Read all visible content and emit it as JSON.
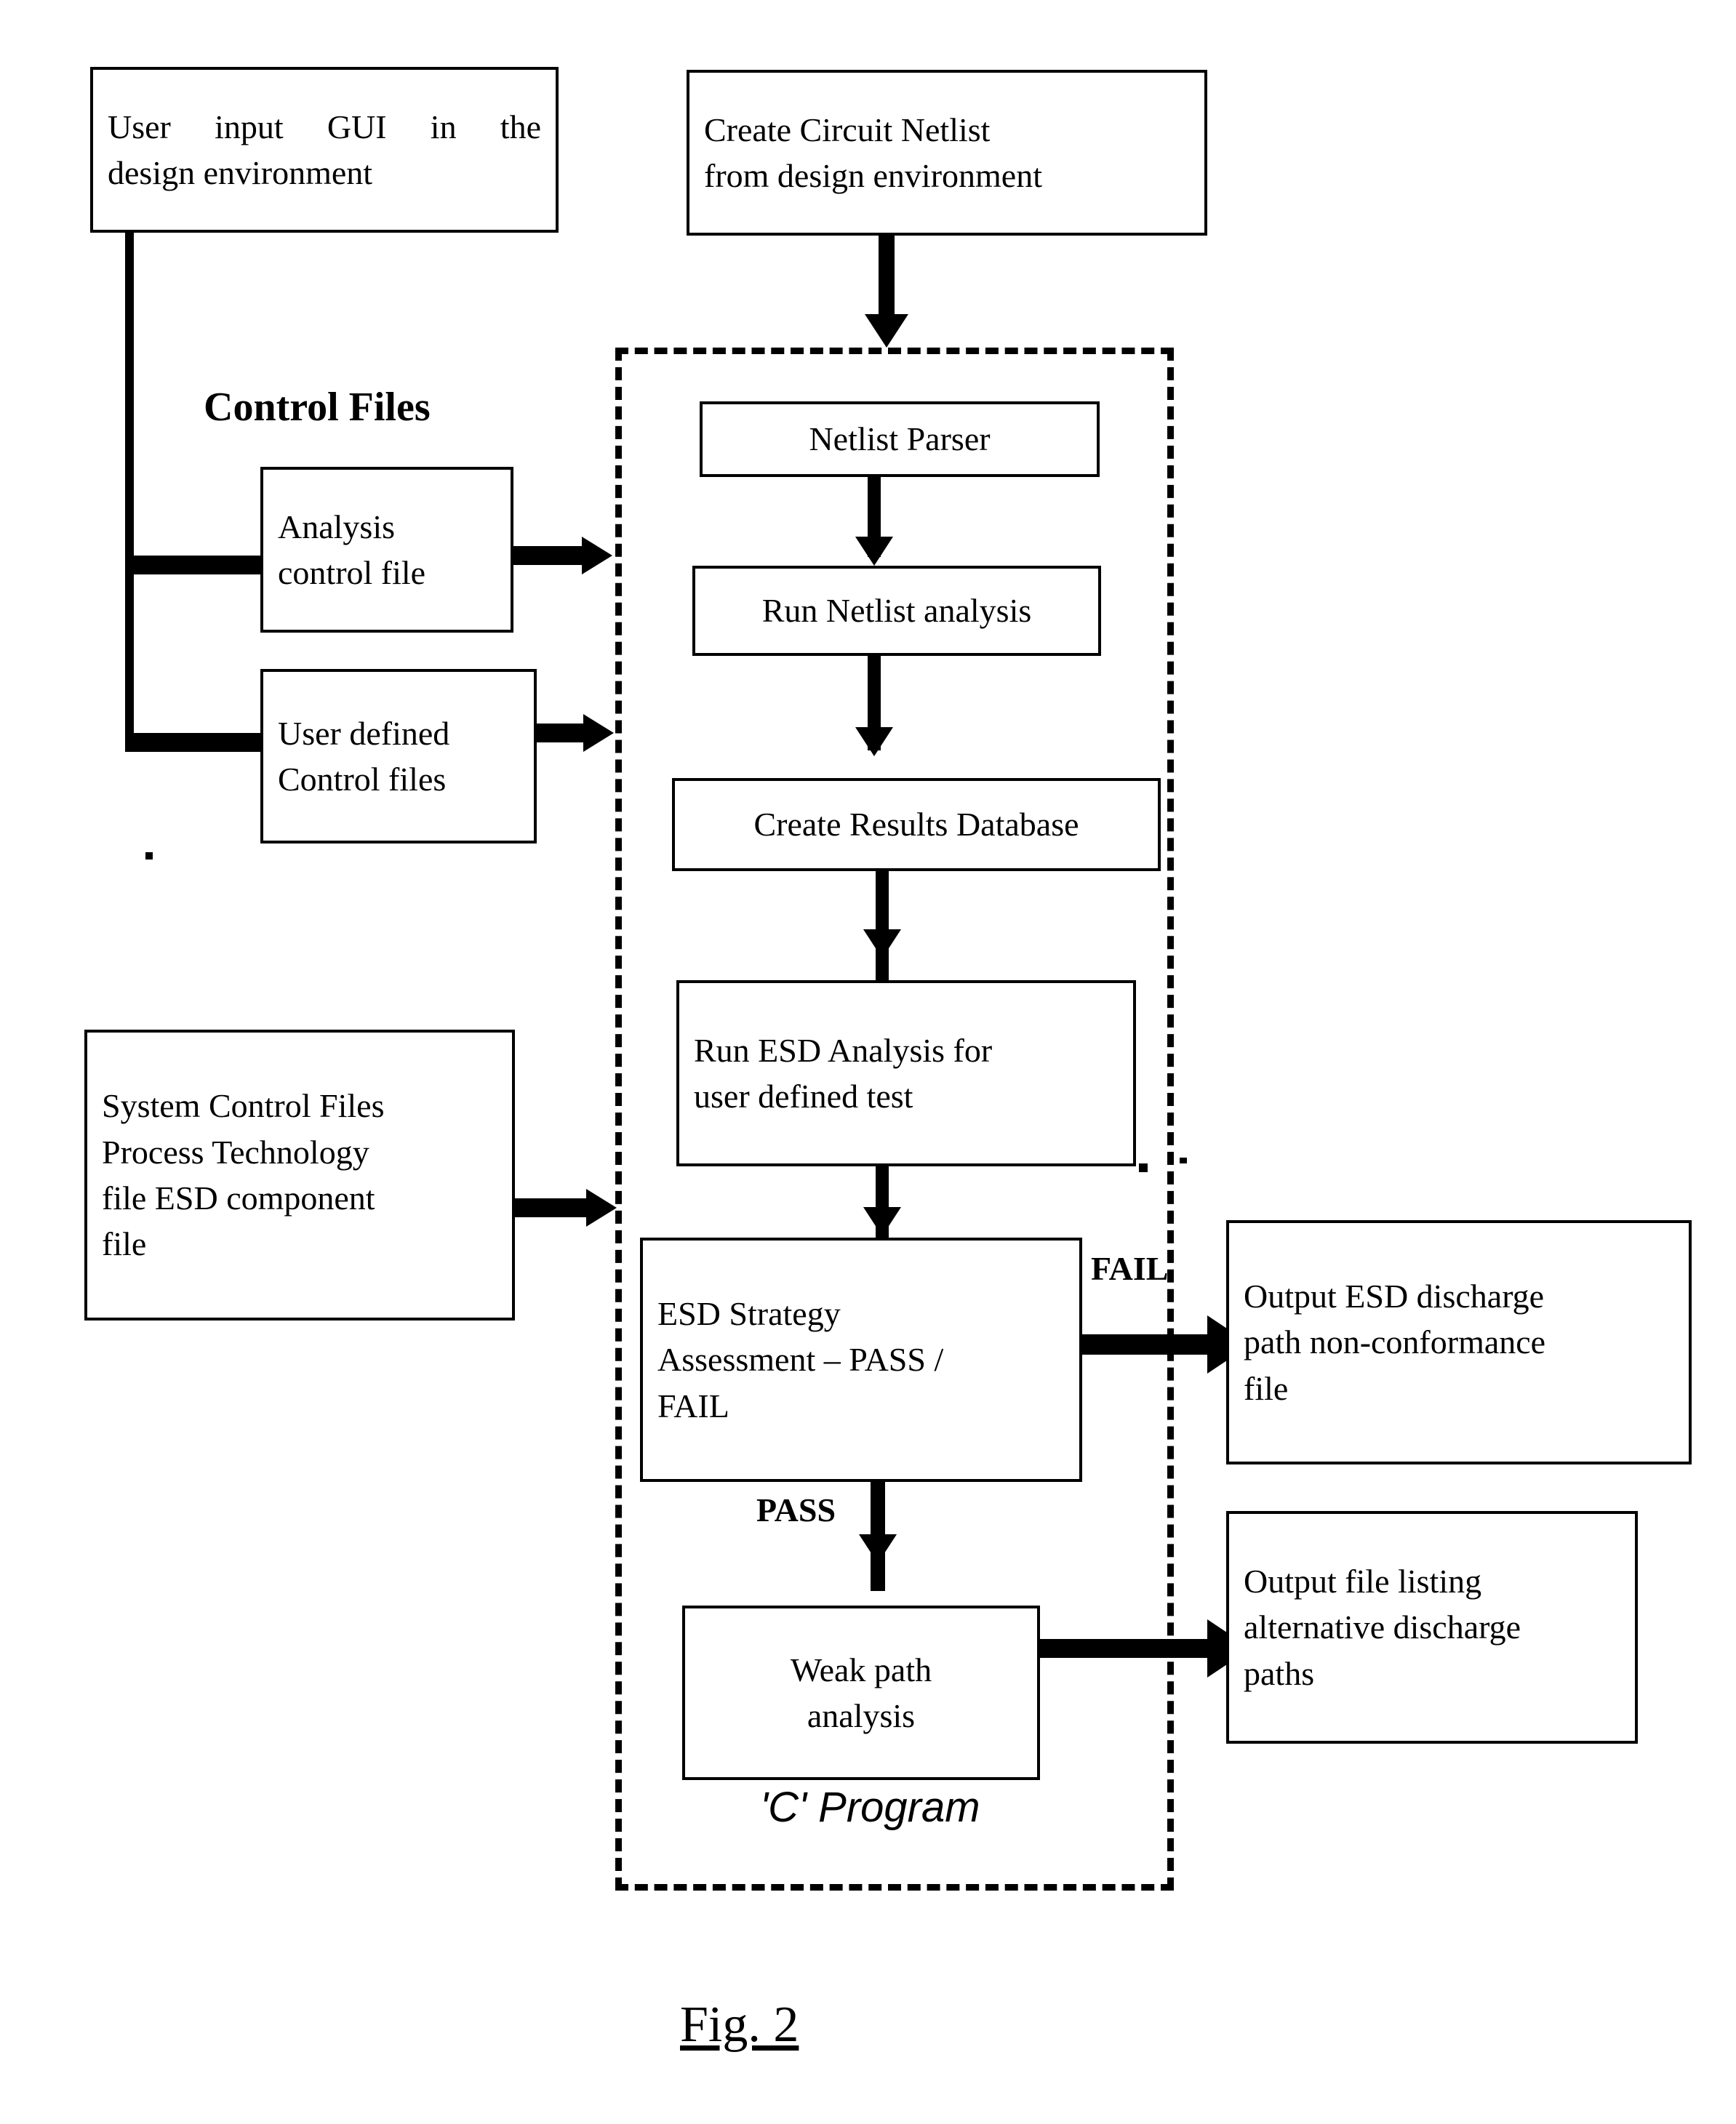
{
  "figure": {
    "caption": "Fig. 2",
    "container_label": "'C' Program"
  },
  "section_labels": {
    "control_files": "Control Files"
  },
  "nodes": {
    "user_input_gui": {
      "lines": [
        "User input GUI in the",
        "design environment"
      ]
    },
    "create_circuit_netlist": {
      "lines": [
        "Create Circuit Netlist",
        "from design environment"
      ]
    },
    "analysis_control_file": {
      "lines": [
        "Analysis",
        "control file"
      ]
    },
    "user_defined_control_files": {
      "lines": [
        "User defined",
        "Control files"
      ]
    },
    "system_control_files": {
      "lines": [
        "System Control Files",
        "Process Technology",
        "file ESD component",
        "file"
      ]
    },
    "netlist_parser": {
      "lines": [
        "Netlist Parser"
      ]
    },
    "run_netlist_analysis": {
      "lines": [
        "Run Netlist analysis"
      ]
    },
    "create_results_database": {
      "lines": [
        "Create Results Database"
      ]
    },
    "run_esd_analysis": {
      "lines": [
        "Run ESD Analysis for",
        "user defined test"
      ]
    },
    "esd_strategy_assessment": {
      "lines": [
        "ESD Strategy",
        "Assessment – PASS /",
        "FAIL"
      ]
    },
    "weak_path_analysis": {
      "lines": [
        "Weak path",
        "analysis"
      ]
    },
    "output_nonconformance": {
      "lines": [
        "Output ESD discharge",
        "path non-conformance",
        "file"
      ]
    },
    "output_alternative_paths": {
      "lines": [
        "Output file listing",
        "alternative discharge",
        "paths"
      ]
    }
  },
  "edge_labels": {
    "fail": "FAIL",
    "pass": "PASS"
  },
  "colors": {
    "stroke": "#000000",
    "background": "#ffffff",
    "text": "#000000"
  }
}
